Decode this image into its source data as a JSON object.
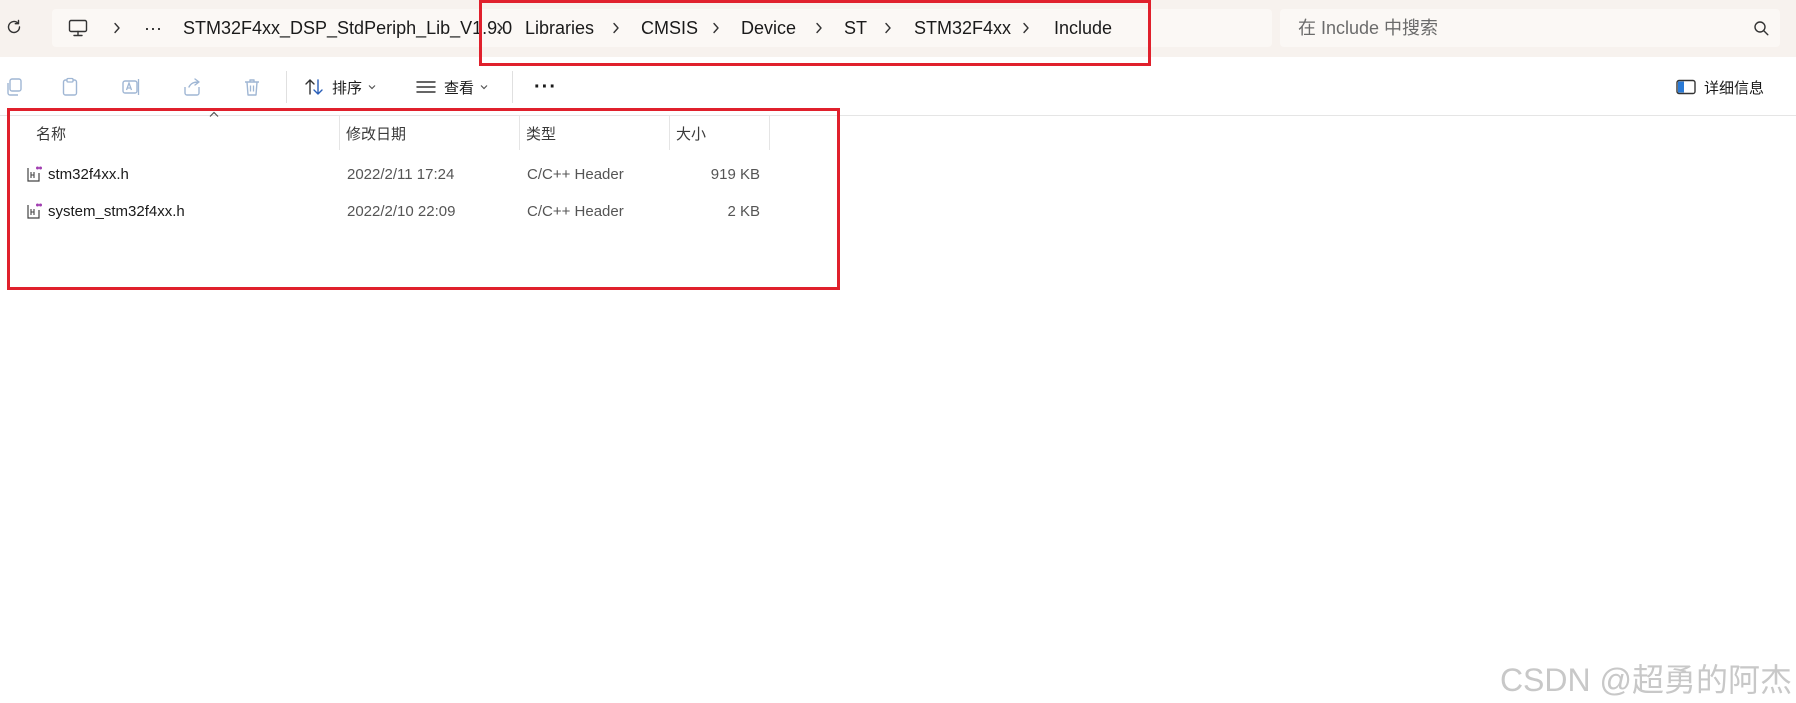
{
  "address_bar": {
    "breadcrumb": [
      "STM32F4xx_DSP_StdPeriph_Lib_V1.9.0",
      "Libraries",
      "CMSIS",
      "Device",
      "ST",
      "STM32F4xx",
      "Include"
    ],
    "overflow_label": "···",
    "search_placeholder": "在 Include 中搜索"
  },
  "toolbar": {
    "sort_label": "排序",
    "view_label": "查看",
    "more_label": "···",
    "details_label": "详细信息"
  },
  "columns": {
    "name": "名称",
    "modified": "修改日期",
    "type": "类型",
    "size": "大小"
  },
  "files": [
    {
      "name": "stm32f4xx.h",
      "modified": "2022/2/11 17:24",
      "type": "C/C++ Header",
      "size": "919 KB"
    },
    {
      "name": "system_stm32f4xx.h",
      "modified": "2022/2/10 22:09",
      "type": "C/C++ Header",
      "size": "2 KB"
    }
  ],
  "watermark": "CSDN @超勇的阿杰",
  "colors": {
    "highlight": "#e0202c",
    "chrome_bg": "#f7f2ee"
  }
}
